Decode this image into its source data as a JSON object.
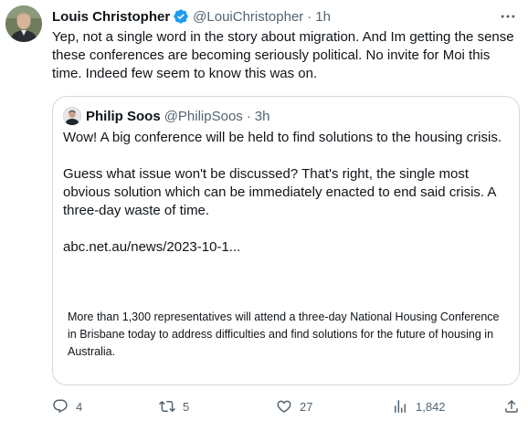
{
  "tweet": {
    "author": {
      "display_name": "Louis Christopher",
      "handle": "@LouiChristopher",
      "verified_icon": "verified-badge-icon",
      "time": "1h"
    },
    "separator": "·",
    "text": "Yep, not a single word in the story about migration. And Im getting the sense these conferences are becoming seriously political. No invite for Moi this time. Indeed few seem to know this was on.",
    "quote": {
      "author": {
        "display_name": "Philip Soos",
        "handle": "@PhilipSoos",
        "time": "3h"
      },
      "paragraphs": [
        "Wow! A big conference will be held to find solutions to the housing crisis.",
        "Guess what issue won't be discussed? That's right, the single most obvious solution which can be immediately enacted to end said crisis. A three-day waste of time."
      ],
      "link": "abc.net.au/news/2023-10-1...",
      "card_text": "More than 1,300 representatives will attend a three-day National Housing Conference in Brisbane today to address difficulties and find solutions for the future of housing in Australia."
    },
    "actions": {
      "replies": "4",
      "retweets": "5",
      "likes": "27",
      "views": "1,842"
    }
  },
  "colors": {
    "text_primary": "#0f1419",
    "text_secondary": "#536471",
    "border": "#cfd9de",
    "verified": "#1d9bf0"
  }
}
